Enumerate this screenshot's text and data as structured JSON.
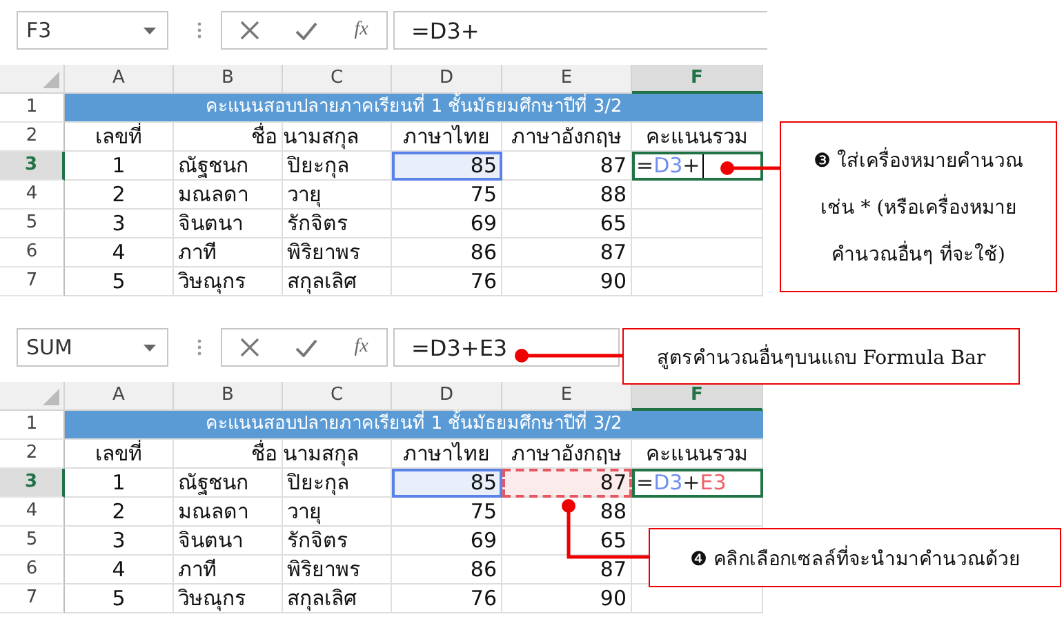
{
  "panels": [
    {
      "name_box": "F3",
      "function_button": "fx",
      "formula": "=D3+",
      "title_row": {
        "row": "1",
        "text": "คะแนนสอบปลายภาคเรียนที่ 1 ชั้นมัธยมศึกษาปีที่ 3/2"
      },
      "columns": [
        {
          "label": "A",
          "selected": false
        },
        {
          "label": "B",
          "selected": false
        },
        {
          "label": "C",
          "selected": false
        },
        {
          "label": "D",
          "selected": false
        },
        {
          "label": "E",
          "selected": false
        },
        {
          "label": "F",
          "selected": true
        }
      ],
      "rows": [
        {
          "row": "2",
          "selected": false,
          "cells": [
            {
              "kind": "header",
              "text": "เลขที่"
            },
            {
              "kind": "header_right",
              "text": "ชื่อ"
            },
            {
              "kind": "header_left",
              "text": "นามสกุล"
            },
            {
              "kind": "header",
              "text": "ภาษาไทย"
            },
            {
              "kind": "header",
              "text": "ภาษาอังกฤษ"
            },
            {
              "kind": "header",
              "text": "คะแนนรวม"
            }
          ]
        },
        {
          "row": "3",
          "selected": true,
          "cells": [
            {
              "kind": "index",
              "text": "1"
            },
            {
              "kind": "text",
              "text": "ณัฐชนก"
            },
            {
              "kind": "text",
              "text": "ปิยะกุล"
            },
            {
              "kind": "number",
              "text": "85",
              "ref": {
                "color": "#5b82e8",
                "dashed": false
              }
            },
            {
              "kind": "number",
              "text": "87"
            },
            {
              "kind": "formula",
              "active": true,
              "cursor": true,
              "parts": [
                {
                  "text": "=",
                  "color": "#222222"
                },
                {
                  "text": "D3",
                  "color": "#6f8ff0"
                },
                {
                  "text": "+",
                  "color": "#222222"
                }
              ]
            }
          ]
        },
        {
          "row": "4",
          "selected": false,
          "cells": [
            {
              "kind": "index",
              "text": "2"
            },
            {
              "kind": "text",
              "text": "มณลดา"
            },
            {
              "kind": "text",
              "text": "วายุ"
            },
            {
              "kind": "number",
              "text": "75"
            },
            {
              "kind": "number",
              "text": "88"
            },
            {
              "kind": "empty"
            }
          ]
        },
        {
          "row": "5",
          "selected": false,
          "cells": [
            {
              "kind": "index",
              "text": "3"
            },
            {
              "kind": "text",
              "text": "จินตนา"
            },
            {
              "kind": "text",
              "text": "รักจิตร"
            },
            {
              "kind": "number",
              "text": "69"
            },
            {
              "kind": "number",
              "text": "65"
            },
            {
              "kind": "empty"
            }
          ]
        },
        {
          "row": "6",
          "selected": false,
          "cells": [
            {
              "kind": "index",
              "text": "4"
            },
            {
              "kind": "text",
              "text": "ภาที"
            },
            {
              "kind": "text",
              "text": "พิริยาพร"
            },
            {
              "kind": "number",
              "text": "86"
            },
            {
              "kind": "number",
              "text": "87"
            },
            {
              "kind": "empty"
            }
          ]
        },
        {
          "row": "7",
          "selected": false,
          "cells": [
            {
              "kind": "index",
              "text": "5"
            },
            {
              "kind": "text",
              "text": "วิษณุกร"
            },
            {
              "kind": "text",
              "text": "สกุลเลิศ"
            },
            {
              "kind": "number",
              "text": "76"
            },
            {
              "kind": "number",
              "text": "90"
            },
            {
              "kind": "empty"
            }
          ]
        }
      ]
    },
    {
      "name_box": "SUM",
      "function_button": "fx",
      "formula": "=D3+E3",
      "title_row": {
        "row": "1",
        "text": "คะแนนสอบปลายภาคเรียนที่ 1 ชั้นมัธยมศึกษาปีที่ 3/2"
      },
      "columns": [
        {
          "label": "A",
          "selected": false
        },
        {
          "label": "B",
          "selected": false
        },
        {
          "label": "C",
          "selected": false
        },
        {
          "label": "D",
          "selected": false
        },
        {
          "label": "E",
          "selected": false
        },
        {
          "label": "F",
          "selected": true
        }
      ],
      "rows": [
        {
          "row": "2",
          "selected": false,
          "cells": [
            {
              "kind": "header",
              "text": "เลขที่"
            },
            {
              "kind": "header_right",
              "text": "ชื่อ"
            },
            {
              "kind": "header_left",
              "text": "นามสกุล"
            },
            {
              "kind": "header",
              "text": "ภาษาไทย"
            },
            {
              "kind": "header",
              "text": "ภาษาอังกฤษ"
            },
            {
              "kind": "header",
              "text": "คะแนนรวม"
            }
          ]
        },
        {
          "row": "3",
          "selected": true,
          "cells": [
            {
              "kind": "index",
              "text": "1"
            },
            {
              "kind": "text",
              "text": "ณัฐชนก"
            },
            {
              "kind": "text",
              "text": "ปิยะกุล"
            },
            {
              "kind": "number",
              "text": "85",
              "ref": {
                "color": "#5b82e8",
                "dashed": false
              }
            },
            {
              "kind": "number",
              "text": "87",
              "ref": {
                "color": "#e8575f",
                "dashed": true
              }
            },
            {
              "kind": "formula",
              "active": true,
              "cursor": false,
              "parts": [
                {
                  "text": "=",
                  "color": "#222222"
                },
                {
                  "text": "D3",
                  "color": "#6f8ff0"
                },
                {
                  "text": "+",
                  "color": "#222222"
                },
                {
                  "text": "E3",
                  "color": "#f0606a"
                }
              ]
            }
          ]
        },
        {
          "row": "4",
          "selected": false,
          "cells": [
            {
              "kind": "index",
              "text": "2"
            },
            {
              "kind": "text",
              "text": "มณลดา"
            },
            {
              "kind": "text",
              "text": "วายุ"
            },
            {
              "kind": "number",
              "text": "75"
            },
            {
              "kind": "number",
              "text": "88"
            },
            {
              "kind": "empty"
            }
          ]
        },
        {
          "row": "5",
          "selected": false,
          "cells": [
            {
              "kind": "index",
              "text": "3"
            },
            {
              "kind": "text",
              "text": "จินตนา"
            },
            {
              "kind": "text",
              "text": "รักจิตร"
            },
            {
              "kind": "number",
              "text": "69"
            },
            {
              "kind": "number",
              "text": "65"
            },
            {
              "kind": "empty"
            }
          ]
        },
        {
          "row": "6",
          "selected": false,
          "cells": [
            {
              "kind": "index",
              "text": "4"
            },
            {
              "kind": "text",
              "text": "ภาที"
            },
            {
              "kind": "text",
              "text": "พิริยาพร"
            },
            {
              "kind": "number",
              "text": "86"
            },
            {
              "kind": "number",
              "text": "87"
            },
            {
              "kind": "empty"
            }
          ]
        },
        {
          "row": "7",
          "selected": false,
          "cells": [
            {
              "kind": "index",
              "text": "5"
            },
            {
              "kind": "text",
              "text": "วิษณุกร"
            },
            {
              "kind": "text",
              "text": "สกุลเลิศ"
            },
            {
              "kind": "number",
              "text": "76"
            },
            {
              "kind": "number",
              "text": "90"
            },
            {
              "kind": "empty"
            }
          ]
        }
      ]
    }
  ],
  "callouts": [
    {
      "lines": [
        "❸ ใส่เครื่องหมายคำนวณ",
        "เช่น * (หรือเครื่องหมาย",
        "คำนวณอื่นๆ ที่จะใช้)"
      ]
    },
    {
      "lines": [
        "สูตรคำนวณอื่นๆบนแถบ Formula Bar"
      ]
    },
    {
      "lines": [
        "❹ คลิกเลือกเซลล์ที่จะนำมาคำนวณด้วย"
      ]
    }
  ]
}
